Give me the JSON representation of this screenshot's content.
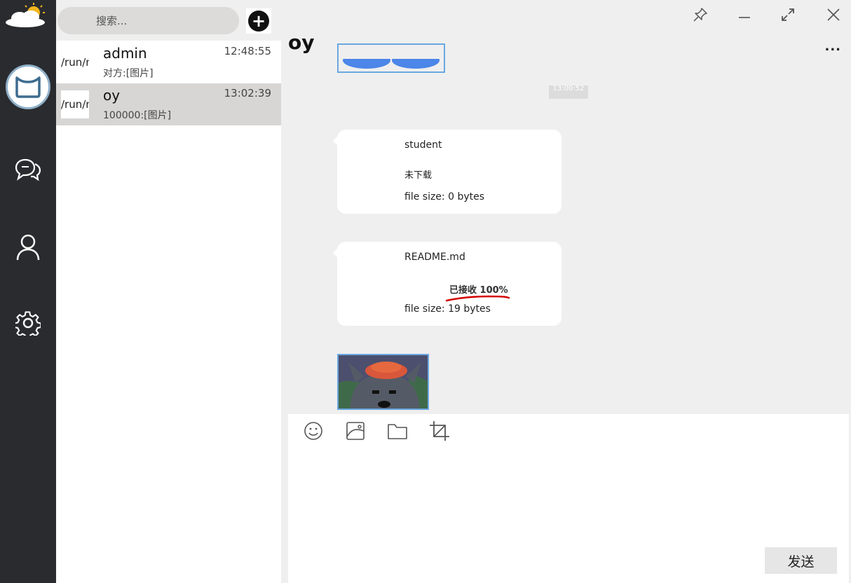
{
  "search": {
    "placeholder": "搜索..."
  },
  "conversations": [
    {
      "avatar_text": "/run/media",
      "name": "admin",
      "time": "12:48:55",
      "preview": "对方:[图片]"
    },
    {
      "avatar_text": "/run/media",
      "name": "oy",
      "time": "13:02:39",
      "preview": "100000:[图片]"
    }
  ],
  "chat": {
    "title": "oy",
    "more": "...",
    "timestamp": "13:00:52",
    "messages": [
      {
        "file_name": "student",
        "status": "未下载",
        "size": "file size: 0 bytes"
      },
      {
        "file_name": "README.md",
        "progress": "已接收 100%",
        "size": "file size: 19 bytes"
      }
    ]
  },
  "input": {
    "send_label": "发送"
  },
  "colors": {
    "rail": "#2a2b2f",
    "active_conv": "#d7d6d5",
    "accent_border": "#6aa7e0",
    "annotation_underline": "#d40000"
  }
}
